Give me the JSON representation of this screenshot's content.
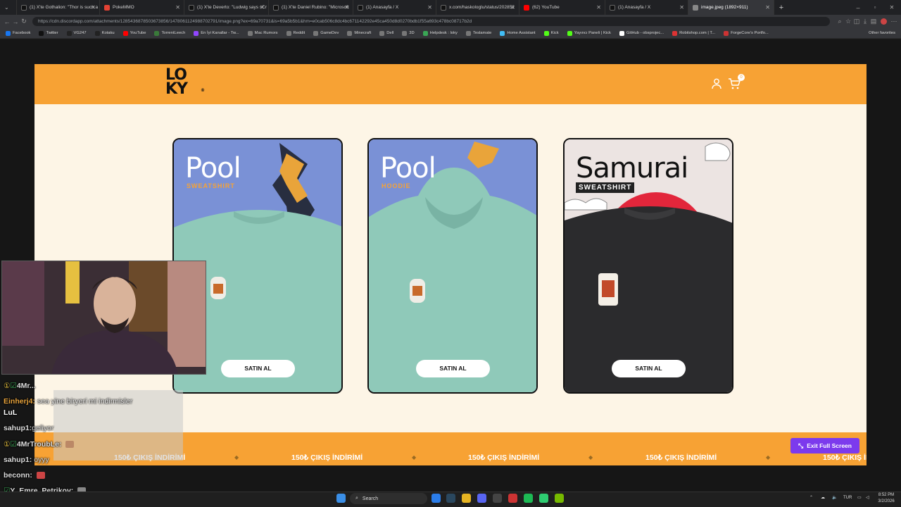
{
  "browser": {
    "tabs": [
      {
        "label": "(1) X'te Gothalion: \"Thor is such a",
        "color": "#111111"
      },
      {
        "label": "PokeMMO",
        "color": "#e34234"
      },
      {
        "label": "(1) X'te Deverto: \"Ludwig says sCr",
        "color": "#111111"
      },
      {
        "label": "(1) X'te Daniel Rubino: \"Microsoft",
        "color": "#111111"
      },
      {
        "label": "(1) Anasayfa / X",
        "color": "#111111"
      },
      {
        "label": "x.com/haskologlu/status/202852",
        "color": "#111111"
      },
      {
        "label": "(62) YouTube",
        "color": "#ff0000"
      },
      {
        "label": "(1) Anasayfa / X",
        "color": "#111111"
      },
      {
        "label": "image.jpeg (1892×911)",
        "color": "#888888"
      }
    ],
    "url": "https://cdn.discordapp.com/attachments/1285436878503673856/1478061124988702791/image.png?ex=69a70731&is=69a5b5b1&hm=e0cab506c8dc4bc671142292e45ca450d8d0270bdb1f55a693c478bc08717b2d",
    "bookmarks": [
      {
        "label": "Facebook",
        "color": "#1877f2"
      },
      {
        "label": "Twitter",
        "color": "#111111"
      },
      {
        "label": "VG247",
        "color": "#222222"
      },
      {
        "label": "Kotaku",
        "color": "#222222"
      },
      {
        "label": "YouTube",
        "color": "#ff0000"
      },
      {
        "label": "TorrentLeech",
        "color": "#3a7a3a"
      },
      {
        "label": "En İyi Kanallar - Tw...",
        "color": "#9146ff"
      },
      {
        "label": "Mac Rumors",
        "color": "#777777"
      },
      {
        "label": "Reddit",
        "color": "#777777"
      },
      {
        "label": "GameDev",
        "color": "#777777"
      },
      {
        "label": "Minecraft",
        "color": "#777777"
      },
      {
        "label": "Dell",
        "color": "#777777"
      },
      {
        "label": "3D",
        "color": "#777777"
      },
      {
        "label": "Helpdesk : loky",
        "color": "#3aa655"
      },
      {
        "label": "Teslamate",
        "color": "#777777"
      },
      {
        "label": "Home Assistant",
        "color": "#41bdf5"
      },
      {
        "label": "Kick",
        "color": "#53fc18"
      },
      {
        "label": "Yayıncı Paneli | Kick",
        "color": "#53fc18"
      },
      {
        "label": "GitHub - obsprojec...",
        "color": "#ffffff"
      },
      {
        "label": "Robitshop.com | T...",
        "color": "#d33"
      },
      {
        "label": "ForgeCore's Portfo...",
        "color": "#cc3333"
      }
    ],
    "other_favorites": "Other favorites"
  },
  "site": {
    "logo_text_top": "LO",
    "logo_text_bottom": "KY",
    "cart_count": "0",
    "products": [
      {
        "title": "Pool",
        "subtitle": "SWEATSHIRT",
        "button": "SATIN AL",
        "bg": "#7a91d6",
        "garment": "#8fc9b9",
        "type": "sweatshirt"
      },
      {
        "title": "Pool",
        "subtitle": "HOODIE",
        "button": "SATIN AL",
        "bg": "#7a91d6",
        "garment": "#8fc9b9",
        "type": "hoodie"
      },
      {
        "title": "Samurai",
        "subtitle": "SWEATSHIRT",
        "button": "SATIN AL",
        "bg": "#e9e1e1",
        "garment": "#2b2b2d",
        "type": "samurai"
      }
    ],
    "marquee_text": "150₺ ÇIKIŞ İNDİRİMİ",
    "exit_fullscreen": "Exit Full Screen"
  },
  "chat": [
    {
      "name": "4Mr...",
      "msg": "",
      "color": "#cfcfcf"
    },
    {
      "name": "Einherj4:",
      "msg": "sea yine biryeri mi indirmisler",
      "color": "#e6a23c"
    },
    {
      "name": "",
      "msg": "LuL",
      "color": "#ffffff"
    },
    {
      "name": "sahup1:",
      "msg": "geliyor",
      "color": "#cfcfcf"
    },
    {
      "name": "4MrTroubLe:",
      "msg": "",
      "color": "#cfcfcf"
    },
    {
      "name": "sahup1:",
      "msg": "oyyy",
      "color": "#cfcfcf"
    },
    {
      "name": "beconn:",
      "msg": "",
      "color": "#cfcfcf"
    },
    {
      "name": "Y_Emre_Petrikov:",
      "msg": "",
      "color": "#cfcfcf"
    }
  ],
  "taskbar": {
    "search": "Search",
    "lang": "TUR",
    "time": "8:52 PM",
    "date": "3/2/2026"
  }
}
